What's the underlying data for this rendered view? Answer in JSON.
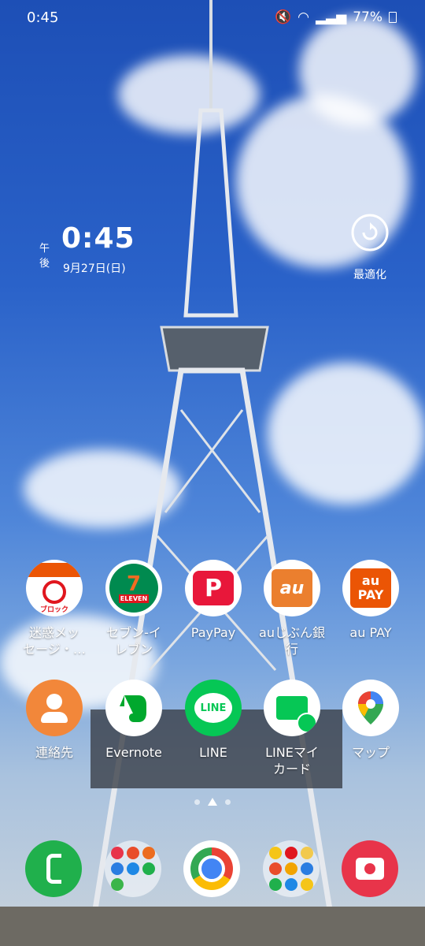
{
  "status_bar": {
    "time": "0:45",
    "battery": "77%"
  },
  "clock_widget": {
    "ampm": "午後",
    "time": "0:45",
    "date": "9月27日(日)"
  },
  "optimize": {
    "label": "最適化"
  },
  "apps_row1": [
    {
      "label": "迷惑メッ\nセージ・…",
      "icon": "block-icon",
      "icon_text": "ブロック"
    },
    {
      "label": "セブン-イ\nレブン",
      "icon": "seven-eleven-icon",
      "icon_text": "ELEVEN"
    },
    {
      "label": "PayPay",
      "icon": "paypay-icon",
      "icon_text": "P"
    },
    {
      "label": "auじぶん銀\n行",
      "icon": "au-jibun-bank-icon",
      "icon_text": "au"
    },
    {
      "label": "au PAY",
      "icon": "au-pay-icon",
      "icon_text": "au PAY"
    }
  ],
  "apps_row2": [
    {
      "label": "連絡先",
      "icon": "contacts-icon"
    },
    {
      "label": "Evernote",
      "icon": "evernote-icon"
    },
    {
      "label": "LINE",
      "icon": "line-icon",
      "icon_text": "LINE"
    },
    {
      "label": "LINEマイ\nカード",
      "icon": "line-mycard-icon"
    },
    {
      "label": "マップ",
      "icon": "maps-icon"
    }
  ],
  "dock": [
    {
      "name": "phone-icon"
    },
    {
      "name": "folder-icon"
    },
    {
      "name": "chrome-icon"
    },
    {
      "name": "folder-icon"
    },
    {
      "name": "camera-icon"
    }
  ],
  "colors": {
    "paypay_red": "#e8173a",
    "au_orange": "#eb5505",
    "line_green": "#06c755",
    "contacts_orange": "#f2873a",
    "phone_green": "#20b04c",
    "camera_red": "#e8344a"
  }
}
